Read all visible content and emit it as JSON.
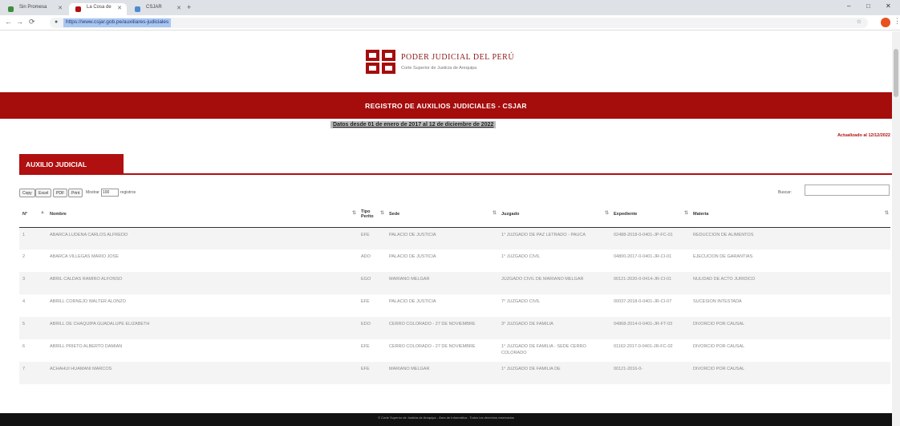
{
  "browser": {
    "tabs": [
      {
        "title": "Sin Promesa",
        "color": "#3c8d3c"
      },
      {
        "title": "La Cosa de",
        "color": "#b01010"
      },
      {
        "title": "CSJAR",
        "color": "#4b8bd4"
      }
    ],
    "url": "https://www.csjar.gob.pe/auxiliares-judiciales",
    "window_controls": [
      "–",
      "□",
      "✕"
    ]
  },
  "header": {
    "org_title": "PODER JUDICIAL DEL PERÚ",
    "org_subtitle": "Corte Superior de Justicia de Arequipa"
  },
  "banner": {
    "title": "REGISTRO DE AUXILIOS JUDICIALES - CSJAR",
    "date_range": "Datos desde 01 de enero de 2017 al 12 de diciembre de 2022",
    "updated": "Actualizado al 12/12/2022"
  },
  "section": {
    "title": "AUXILIO JUDICIAL"
  },
  "toolbar": {
    "buttons": [
      "Copy",
      "Excel",
      "PDF",
      "Print"
    ],
    "show_label": "Mostrar",
    "show_value": "100",
    "show_after": "registros",
    "search_label": "Buscar:"
  },
  "table": {
    "headers": [
      "N°",
      "Nombre",
      "Tipo Perito",
      "Sede",
      "Juzgado",
      "Expediente",
      "Materia"
    ],
    "rows": [
      [
        "1",
        "ABARCA LUDENA CARLOS ALFREDO",
        "EFE",
        "PALACIO DE JUSTICIA",
        "1° JUZGADO DE PAZ LETRADO - PAUCA",
        "02488-2018-0-0401-JP-FC-01",
        "REDUCCION DE ALIMENTOS"
      ],
      [
        "2",
        "ABARCA VILLEGAS MARIO JOSE",
        "ADO",
        "PALACIO DE JUSTICIA",
        "1° JUZGADO CIVIL",
        "04800-2017-0-0401-JR-CI-01",
        "EJECUCION DE GARANTIAS"
      ],
      [
        "3",
        "ABRIL CALDAS RAMIRO ALFONSO",
        "EGO",
        "MARIANO MELGAR",
        "JUZGADO CIVIL DE MARIANO MELGAR",
        "00121-2020-0-0414-JR-CI-01",
        "NULIDAD DE ACTO JURIDICO"
      ],
      [
        "4",
        "ABRILL CORNEJO WALTER ALONZO",
        "EFE",
        "PALACIO DE JUSTICIA",
        "7° JUZGADO CIVIL",
        "00037-2018-0-0401-JR-CI-07",
        "SUCESION INTESTADA"
      ],
      [
        "5",
        "ABRILL DE CHAQUIPA GUADALUPE ELIZABETH",
        "EDO",
        "CERRO COLORADO - 27 DE NOVIEMBRE",
        "3° JUZGADO DE FAMILIA",
        "04868-2014-0-0401-JR-FT-03",
        "DIVORCIO POR CAUSAL"
      ],
      [
        "6",
        "ABRILL PRIETO ALBERTO DAMIAN",
        "EFE",
        "CERRO COLORADO - 27 DE NOVIEMBRE",
        "1° JUZGADO DE FAMILIA - SEDE CERRO COLORADO",
        "01162-2017-0-0401-JR-FC-02",
        "DIVORCIO POR CAUSAL"
      ],
      [
        "7",
        "ACHAHUI HUAMANI MARCOS",
        "EFE",
        "MARIANO MELGAR",
        "1° JUZGADO DE FAMILIA DE",
        "00121-2016-0-",
        "DIVORCIO POR CAUSAL"
      ]
    ]
  },
  "footer": {
    "text": "© Corte Superior de Justicia de Arequipa - Área de Informática - Todos los derechos reservados"
  }
}
